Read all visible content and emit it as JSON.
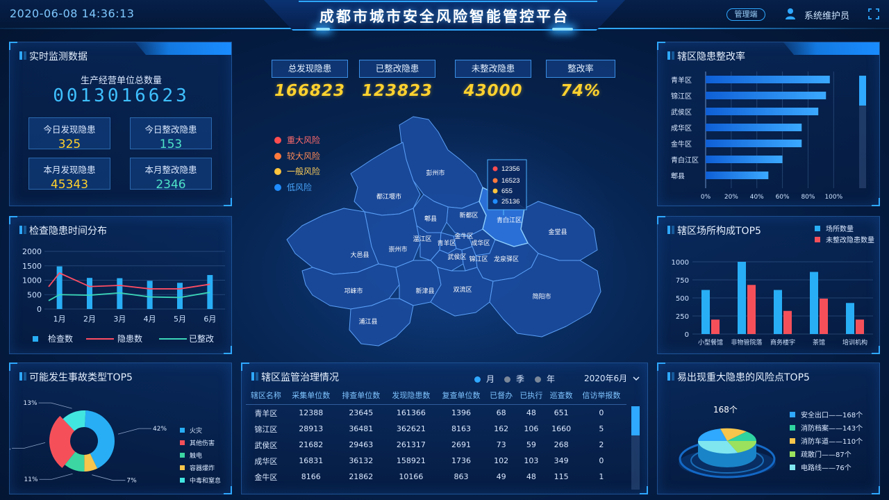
{
  "header": {
    "datetime": "2020-06-08 14:36:13",
    "title": "成都市城市安全风险智能管控平台",
    "mode_button": "管理端",
    "user_name": "系统维护员"
  },
  "realtime": {
    "title": "实时监测数据",
    "total_label": "生产经营单位总数量",
    "total_value": "0013016623",
    "boxes": [
      {
        "label": "今日发现隐患",
        "value": "325"
      },
      {
        "label": "今日整改隐患",
        "value": "153"
      },
      {
        "label": "本月发现隐患",
        "value": "45343"
      },
      {
        "label": "本月整改隐患",
        "value": "2346"
      }
    ]
  },
  "top_kpis": [
    {
      "label": "总发现隐患",
      "value": "166823"
    },
    {
      "label": "已整改隐患",
      "value": "123823"
    },
    {
      "label": "未整改隐患",
      "value": "43000"
    },
    {
      "label": "整改率",
      "value": "74%"
    }
  ],
  "risk_legend": [
    {
      "label": "重大风险",
      "color": "#ff4d4f"
    },
    {
      "label": "较大风险",
      "color": "#ff7a3c"
    },
    {
      "label": "一般风险",
      "color": "#ffc53d"
    },
    {
      "label": "低风险",
      "color": "#1f8cff"
    }
  ],
  "map": {
    "districts": [
      "彭州市",
      "都江堰市",
      "郫县",
      "新都区",
      "青白江区",
      "金堂县",
      "温江区",
      "青羊区",
      "金牛区",
      "成华区",
      "崇州市",
      "大邑县",
      "武侯区",
      "锦江区",
      "龙泉驿区",
      "邛崃市",
      "新津县",
      "双流区",
      "简阳市",
      "浦江县"
    ],
    "tooltip": [
      "12356",
      "16523",
      "655",
      "25136"
    ]
  },
  "rectify_rate": {
    "title": "辖区隐患整改率",
    "categories": [
      "青羊区",
      "锦江区",
      "武侯区",
      "成华区",
      "金牛区",
      "青白江区",
      "郫县"
    ],
    "values": [
      97,
      94,
      88,
      75,
      75,
      60,
      49
    ],
    "xticks": [
      "0%",
      "20%",
      "40%",
      "60%",
      "80%",
      "100%"
    ]
  },
  "time_dist": {
    "title": "检查隐患时间分布",
    "chart_data": {
      "type": "bar",
      "categories": [
        "1月",
        "2月",
        "3月",
        "4月",
        "5月",
        "6月"
      ],
      "ylim": [
        0,
        1500
      ],
      "yticks": [
        "0",
        "500",
        "1000",
        "1500",
        "2000"
      ],
      "series": [
        {
          "name": "检查数",
          "type": "bar",
          "values": [
            1480,
            1080,
            1070,
            980,
            910,
            1180
          ]
        },
        {
          "name": "隐患数",
          "type": "line",
          "values": [
            1250,
            780,
            820,
            700,
            700,
            860
          ]
        },
        {
          "name": "已整改",
          "type": "line",
          "values": [
            500,
            480,
            560,
            420,
            400,
            580
          ]
        }
      ]
    }
  },
  "venue_top5": {
    "title": "辖区场所构成TOP5",
    "chart_data": {
      "type": "bar",
      "categories": [
        "小型餐馆",
        "非物管院落",
        "商务楼宇",
        "茶馆",
        "培训机构"
      ],
      "ylim": [
        0,
        1000
      ],
      "yticks": [
        "0",
        "250",
        "500",
        "750",
        "1000"
      ],
      "series": [
        {
          "name": "场所数量",
          "values": [
            610,
            1000,
            610,
            860,
            430
          ]
        },
        {
          "name": "未整改隐患数量",
          "values": [
            200,
            680,
            320,
            490,
            200
          ]
        }
      ]
    }
  },
  "accident_top5": {
    "title": "可能发生事故类型TOP5",
    "chart_data": {
      "type": "pie",
      "categories": [
        "火灾",
        "其他伤害",
        "触电",
        "容器爆炸",
        "中毒和窒息"
      ],
      "values": [
        42,
        27,
        11,
        7,
        13
      ],
      "labels": [
        "42%",
        "27%",
        "11%",
        "7%",
        "13%"
      ],
      "colors": [
        "#28aef5",
        "#f5505a",
        "#3bd6a2",
        "#f7c54b",
        "#42e6e0"
      ]
    }
  },
  "governance": {
    "title": "辖区监管治理情况",
    "period_options": [
      "月",
      "季",
      "年"
    ],
    "selected_month": "2020年6月",
    "columns": [
      "辖区名称",
      "采集单位数",
      "排查单位数",
      "发现隐患数",
      "复查单位数",
      "已督办",
      "已执行",
      "巡查数",
      "信访举报数"
    ],
    "rows": [
      [
        "青羊区",
        "12388",
        "23645",
        "161366",
        "1396",
        "68",
        "48",
        "651",
        "0"
      ],
      [
        "锦江区",
        "28913",
        "36481",
        "362621",
        "8163",
        "162",
        "106",
        "1660",
        "5"
      ],
      [
        "武侯区",
        "21682",
        "29463",
        "261317",
        "2691",
        "73",
        "59",
        "268",
        "2"
      ],
      [
        "成华区",
        "16831",
        "36132",
        "158921",
        "1736",
        "102",
        "103",
        "349",
        "0"
      ],
      [
        "金牛区",
        "8166",
        "21862",
        "10166",
        "863",
        "49",
        "48",
        "115",
        "1"
      ]
    ]
  },
  "risk_points": {
    "title": "易出现重大隐患的风险点TOP5",
    "center_label": "168个",
    "items": [
      {
        "label": "安全出口——168个",
        "color": "#2fa8ff"
      },
      {
        "label": "消防档案——143个",
        "color": "#2fd3a0"
      },
      {
        "label": "消防车道——110个",
        "color": "#f7c54b"
      },
      {
        "label": "疏散门——87个",
        "color": "#9be15d"
      },
      {
        "label": "电路线——76个",
        "color": "#7fe6f0"
      }
    ]
  }
}
